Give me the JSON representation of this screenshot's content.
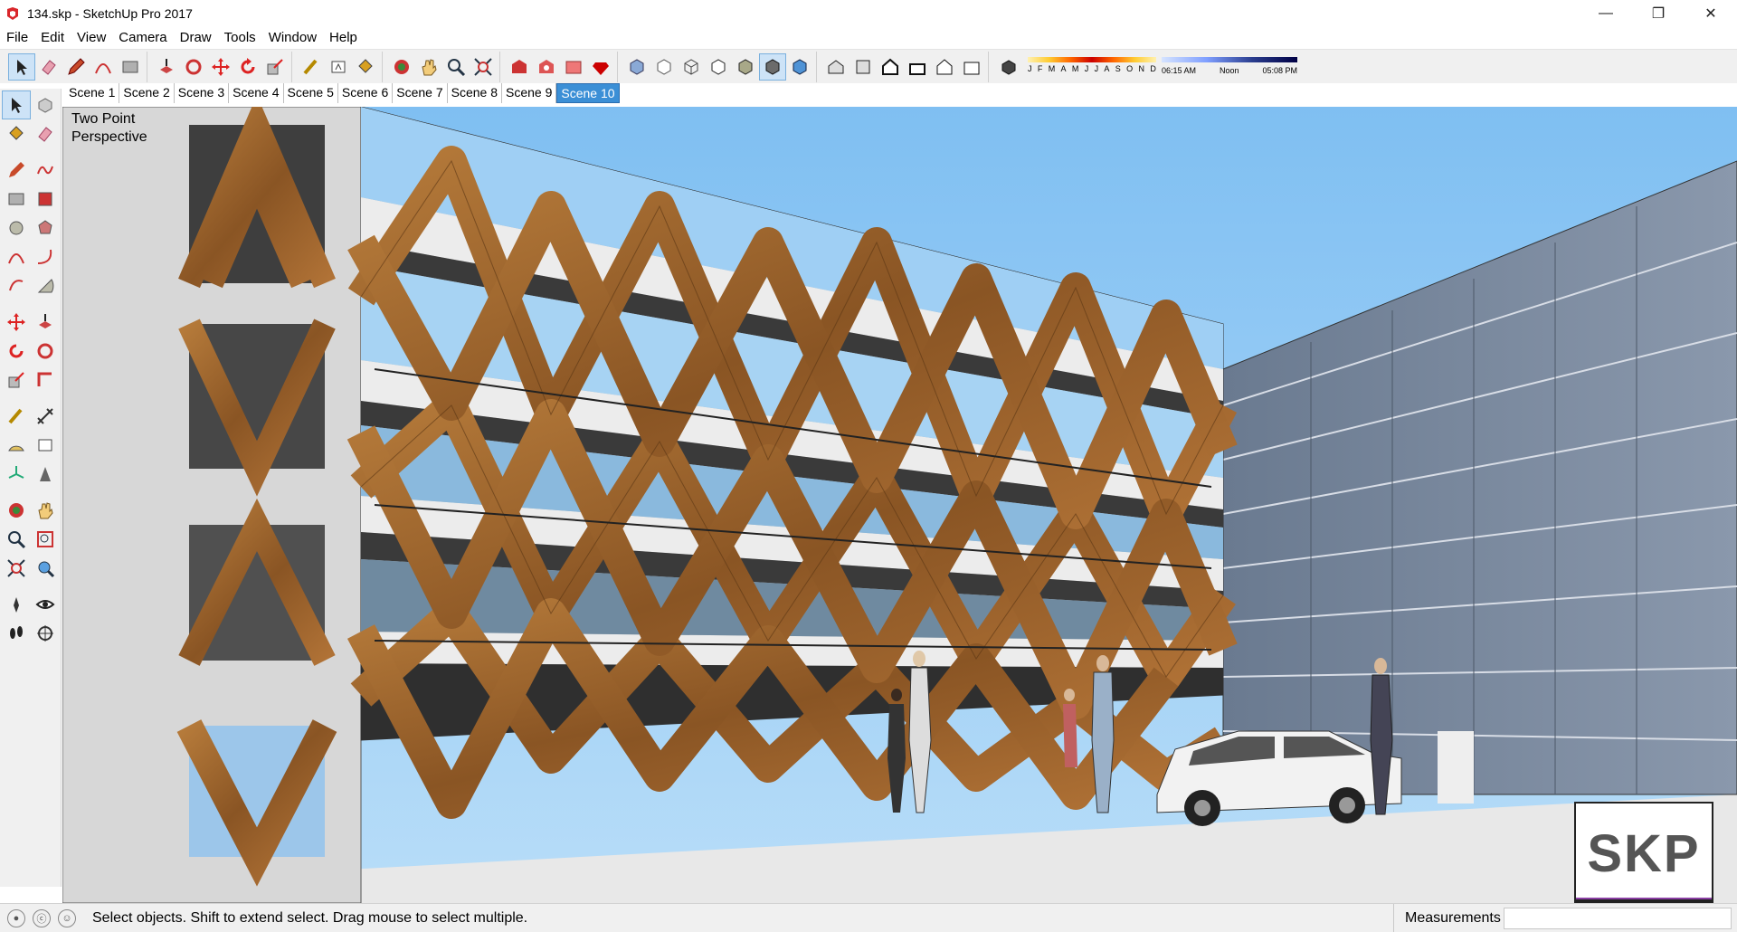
{
  "window": {
    "title": "134.skp - SketchUp Pro 2017",
    "app_icon": "sketchup-logo-icon",
    "minimize": "—",
    "maximize": "❐",
    "close": "✕"
  },
  "menu": [
    "File",
    "Edit",
    "View",
    "Camera",
    "Draw",
    "Tools",
    "Window",
    "Help"
  ],
  "scenes": {
    "tabs": [
      "Scene 1",
      "Scene 2",
      "Scene 3",
      "Scene 4",
      "Scene 5",
      "Scene 6",
      "Scene 7",
      "Scene 8",
      "Scene 9",
      "Scene 10"
    ],
    "active": "Scene 10"
  },
  "shadow": {
    "months": [
      "J",
      "F",
      "M",
      "A",
      "M",
      "J",
      "J",
      "A",
      "S",
      "O",
      "N",
      "D"
    ],
    "time_start": "06:15 AM",
    "time_mid": "Noon",
    "time_end": "05:08 PM"
  },
  "viewport": {
    "camera_label": "Two Point Perspective",
    "logo_text": "SKP",
    "sky_color": "#8fc9f4",
    "wood_color": "#a46b2f"
  },
  "status": {
    "message": "Select objects. Shift to extend select. Drag mouse to select multiple.",
    "measurements_label": "Measurements",
    "measurements_value": ""
  },
  "colors": {
    "accent": "#3b8fd6",
    "toolbar_bg": "#f0f0f0"
  }
}
